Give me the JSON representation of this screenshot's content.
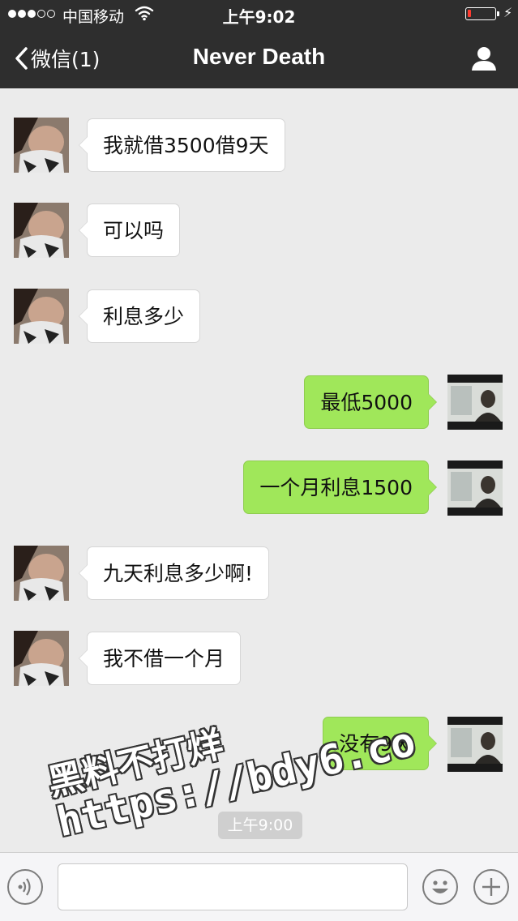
{
  "status_bar": {
    "carrier": "中国移动",
    "time": "上午9:02",
    "signal_bars_filled": 3,
    "signal_bars_total": 5,
    "battery_level_fraction": 0.12,
    "wifi_icon": "wifi-icon",
    "charging_icon": "bolt-icon"
  },
  "nav": {
    "back_label": "微信(1)",
    "title": "Never Death",
    "profile_icon": "person-icon"
  },
  "messages": [
    {
      "from": "her",
      "text": "我就借3500借9天"
    },
    {
      "from": "her",
      "text": "可以吗"
    },
    {
      "from": "her",
      "text": "利息多少"
    },
    {
      "from": "me",
      "text": "最低5000"
    },
    {
      "from": "me",
      "text": "一个月利息1500"
    },
    {
      "from": "her",
      "text": "九天利息多少啊!"
    },
    {
      "from": "her",
      "text": "我不借一个月"
    },
    {
      "from": "me",
      "text": "没有9天"
    }
  ],
  "timestamp_chip": "上午9:00",
  "watermark": {
    "line1": "黑料不打烊",
    "line2": "https://bdy6.co"
  },
  "input_bar": {
    "voice_icon": "voice-icon",
    "emoji_icon": "emoji-icon",
    "plus_icon": "plus-icon",
    "input_value": ""
  },
  "colors": {
    "nav_bg": "#2e2e2e",
    "chat_bg": "#ebebeb",
    "outgoing_bubble": "#a0e75a",
    "incoming_bubble": "#ffffff",
    "battery_low": "#ff3b30"
  }
}
